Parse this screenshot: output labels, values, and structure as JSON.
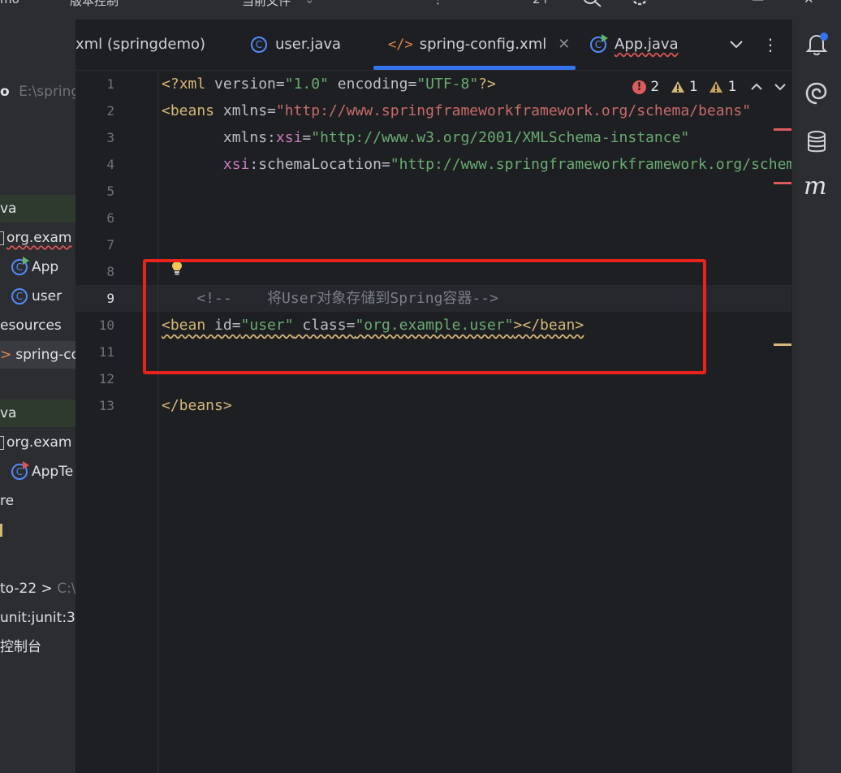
{
  "topbar": {
    "menu_left": "mo",
    "menu_mid": "版本控制",
    "menu_file": "当前文件"
  },
  "project_tree": {
    "root_label": "o",
    "root_path": "E:\\spring",
    "items": [
      {
        "label": "va"
      },
      {
        "label": "org.exam"
      },
      {
        "label": "App"
      },
      {
        "label": "user"
      },
      {
        "label": "esources"
      },
      {
        "label": "spring-co"
      },
      {
        "label": "va"
      },
      {
        "label": "org.exam"
      },
      {
        "label": "AppTe"
      },
      {
        "label": "re"
      },
      {
        "label": "to-22 >",
        "extra": "C:\\"
      },
      {
        "label": "unit:junit:3"
      },
      {
        "label": "控制台"
      }
    ]
  },
  "tabs": [
    {
      "label": "xml (springdemo)"
    },
    {
      "label": "user.java",
      "icon": "class-icon"
    },
    {
      "label": "spring-config.xml",
      "icon": "xml-icon",
      "active": true
    },
    {
      "label": "App.java",
      "icon": "run-class-icon"
    }
  ],
  "inspections": {
    "errors": "2",
    "weak_warnings": "1",
    "warnings": "1"
  },
  "editor": {
    "line_numbers": [
      "1",
      "2",
      "3",
      "4",
      "5",
      "6",
      "7",
      "8",
      "9",
      "10",
      "11",
      "12",
      "13"
    ],
    "current_line": "9",
    "line1": {
      "open": "<?",
      "name": "xml",
      "attr1": " version=",
      "val1": "\"1.0\"",
      "attr2": " encoding=",
      "val2": "\"UTF-8\"",
      "close": "?>"
    },
    "line2": {
      "open": "<beans",
      "attr": " xmlns=",
      "val": "\"http://www.springframeworkframework.org/schema/beans\""
    },
    "line3": {
      "pad": "       ",
      "attr": "xmlns:",
      "ns": "xsi",
      "eq": "=",
      "val": "\"http://www.w3.org/2001/XMLSchema-instance\""
    },
    "line4": {
      "pad": "       ",
      "ns": "xsi",
      "attr": ":schemaLocation=",
      "val": "\"http://www.springframeworkframework.org/schema/beans\""
    },
    "line9": {
      "comment": "    <!--    将User对象存储到Spring容器-->"
    },
    "line10": {
      "open": "<bean",
      "attr1": " id=",
      "val1": "\"user\"",
      "attr2": " class=",
      "val2": "\"org.example.user\"",
      "close": "></bean>"
    },
    "line13": {
      "close": "</beans>"
    }
  },
  "colors": {
    "highlight_box": "#e8231b",
    "tab_underline": "#3574f0"
  }
}
